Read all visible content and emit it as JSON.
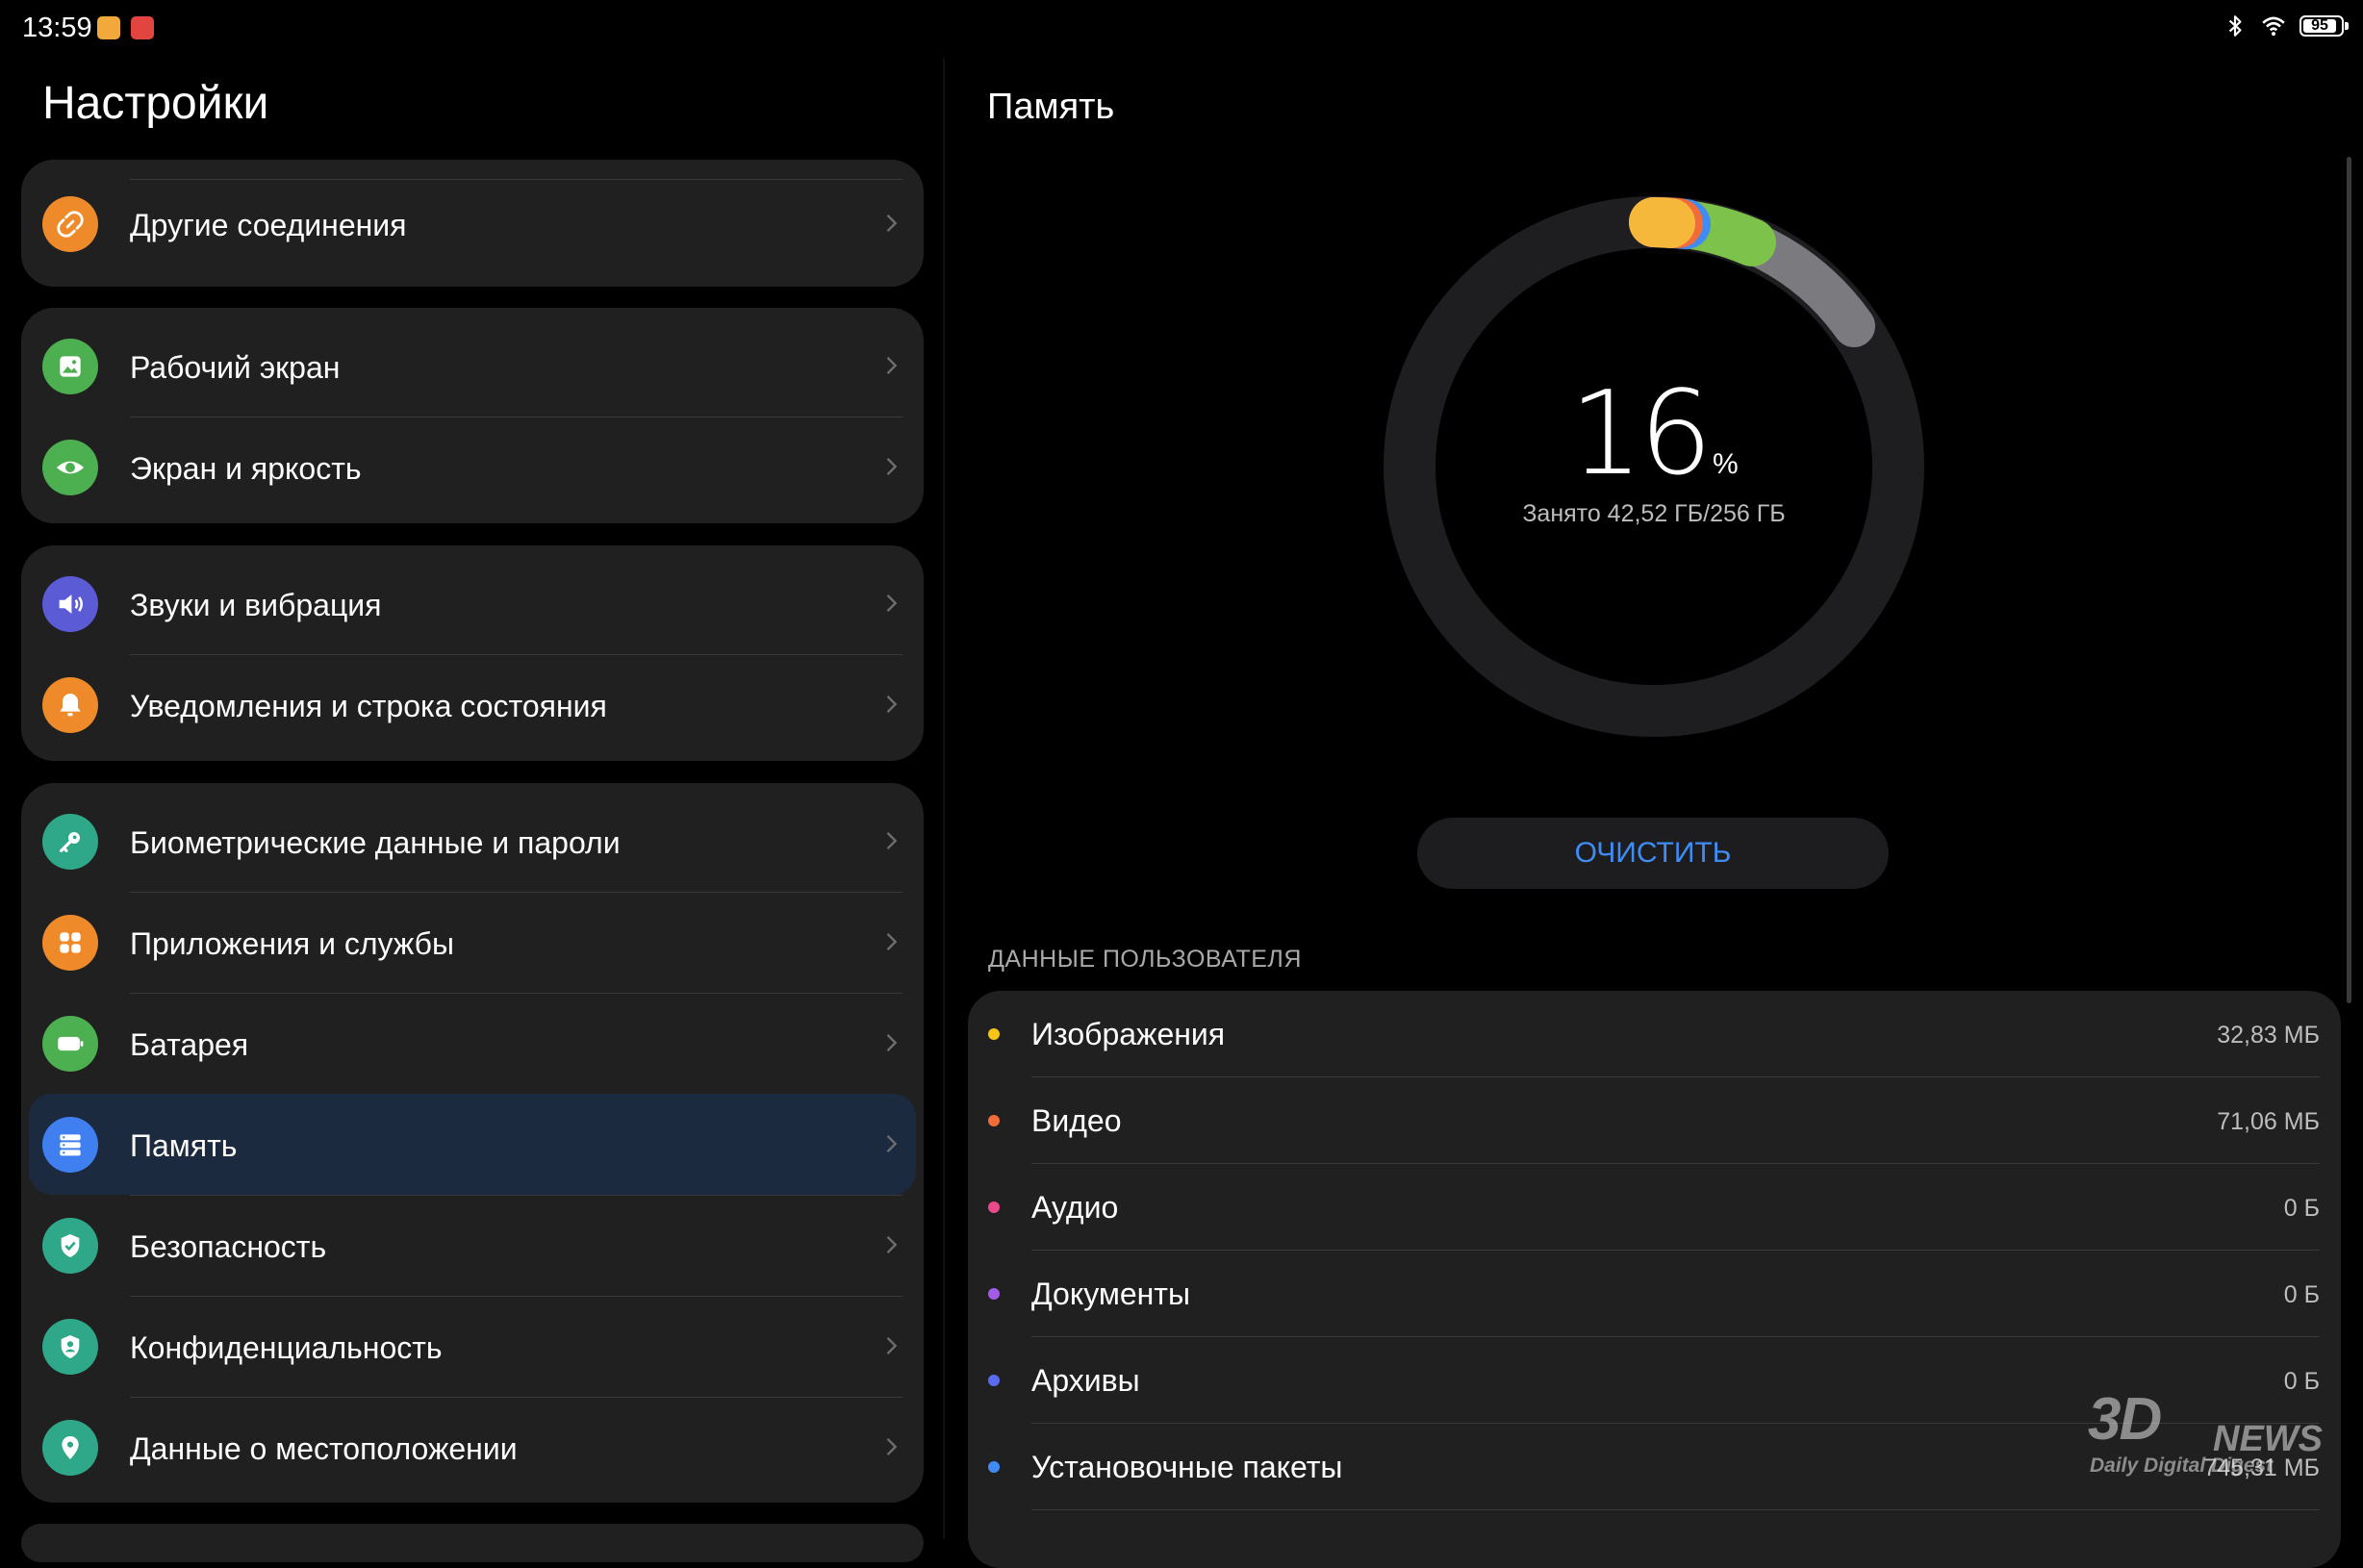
{
  "status_bar": {
    "time": "13:59",
    "battery": "95",
    "icons": [
      "notification-app-icon",
      "notification-app-icon",
      "bluetooth-icon",
      "wifi-icon",
      "battery-icon"
    ]
  },
  "left_panel": {
    "title": "Настройки",
    "groups": [
      {
        "items": [
          {
            "label": "Другие соединения",
            "icon": "link-icon",
            "color": "#ef8a2b"
          }
        ]
      },
      {
        "items": [
          {
            "label": "Рабочий экран",
            "icon": "image-icon",
            "color": "#4caf50"
          },
          {
            "label": "Экран и яркость",
            "icon": "eye-icon",
            "color": "#4caf50"
          }
        ]
      },
      {
        "items": [
          {
            "label": "Звуки и вибрация",
            "icon": "speaker-icon",
            "color": "#5b5bd6"
          },
          {
            "label": "Уведомления и строка состояния",
            "icon": "bell-icon",
            "color": "#ef8a2b"
          }
        ]
      },
      {
        "items": [
          {
            "label": "Биометрические данные и пароли",
            "icon": "key-icon",
            "color": "#2fa889"
          },
          {
            "label": "Приложения и службы",
            "icon": "apps-icon",
            "color": "#ef8a2b"
          },
          {
            "label": "Батарея",
            "icon": "battery-icon",
            "color": "#4caf50"
          },
          {
            "label": "Память",
            "icon": "storage-icon",
            "color": "#3f7ff0",
            "selected": true
          },
          {
            "label": "Безопасность",
            "icon": "shield-icon",
            "color": "#2fa889"
          },
          {
            "label": "Конфиденциальность",
            "icon": "privacy-icon",
            "color": "#2fa889"
          },
          {
            "label": "Данные о местоположении",
            "icon": "location-icon",
            "color": "#2fa889"
          }
        ]
      }
    ]
  },
  "right_panel": {
    "title": "Память",
    "usage_percent": 16,
    "percent_sign": "%",
    "used_text": "Занято 42,52 ГБ/256 ГБ",
    "ring_segments": [
      {
        "name": "images",
        "color": "#f5c518"
      },
      {
        "name": "video",
        "color": "#f26c3a"
      },
      {
        "name": "audio",
        "color": "#e94b8a"
      },
      {
        "name": "documents",
        "color": "#a35ce6"
      },
      {
        "name": "archives",
        "color": "#5b6bf0"
      },
      {
        "name": "packages",
        "color": "#3f8cf5"
      },
      {
        "name": "apps",
        "color": "#7dc24a"
      },
      {
        "name": "system",
        "color": "#8b8b90"
      }
    ],
    "clean_button": "ОЧИСТИТЬ",
    "section_header": "ДАННЫЕ ПОЛЬЗОВАТЕЛЯ",
    "items": [
      {
        "label": "Изображения",
        "value": "32,83 МБ",
        "color": "#f5c518"
      },
      {
        "label": "Видео",
        "value": "71,06 МБ",
        "color": "#f26c3a"
      },
      {
        "label": "Аудио",
        "value": "0 Б",
        "color": "#e94b8a"
      },
      {
        "label": "Документы",
        "value": "0 Б",
        "color": "#a35ce6"
      },
      {
        "label": "Архивы",
        "value": "0 Б",
        "color": "#5b6bf0"
      },
      {
        "label": "Установочные пакеты",
        "value": "745,31 МБ",
        "color": "#3f8cf5"
      }
    ]
  },
  "watermark": {
    "brand": "3D",
    "brand2": "NEWS",
    "tagline": "Daily Digital Digest"
  }
}
